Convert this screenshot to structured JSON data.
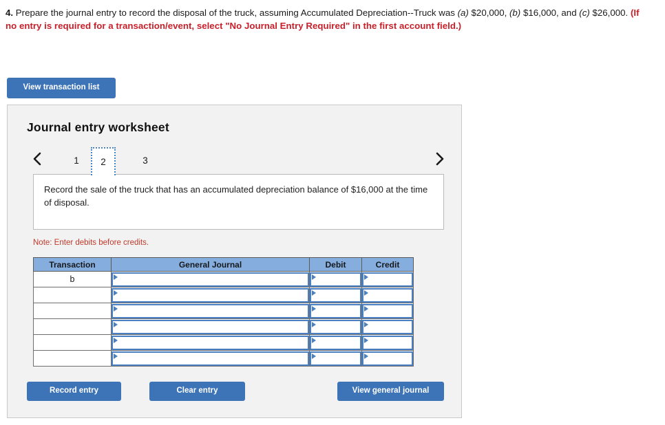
{
  "question": {
    "number": "4.",
    "part1": "Prepare the journal entry to record the disposal of the truck, assuming Accumulated Depreciation--Truck was ",
    "a_label": "(a)",
    "a_value": " $20,000, ",
    "b_label": "(b)",
    "b_value": " $16,000, and ",
    "c_label": "(c)",
    "c_value": " $26,000. ",
    "red_note": "(If no entry is required for a transaction/event, select \"No Journal Entry Required\" in the first account field.)"
  },
  "toolbar": {
    "view_transaction_list": "View transaction list"
  },
  "panel": {
    "title": "Journal entry worksheet",
    "nav": {
      "prev_icon": "chevron-left-icon",
      "next_icon": "chevron-right-icon",
      "tabs": [
        {
          "label": "1",
          "active": false
        },
        {
          "label": "2",
          "active": true
        },
        {
          "label": "3",
          "active": false
        }
      ]
    },
    "description": "Record the sale of the truck that has an accumulated depreciation balance of $16,000 at the time of disposal.",
    "note": "Note: Enter debits before credits."
  },
  "table": {
    "headers": [
      "Transaction",
      "General Journal",
      "Debit",
      "Credit"
    ],
    "rows": [
      {
        "transaction": "b",
        "general_journal": "",
        "debit": "",
        "credit": ""
      },
      {
        "transaction": "",
        "general_journal": "",
        "debit": "",
        "credit": ""
      },
      {
        "transaction": "",
        "general_journal": "",
        "debit": "",
        "credit": ""
      },
      {
        "transaction": "",
        "general_journal": "",
        "debit": "",
        "credit": ""
      },
      {
        "transaction": "",
        "general_journal": "",
        "debit": "",
        "credit": ""
      },
      {
        "transaction": "",
        "general_journal": "",
        "debit": "",
        "credit": ""
      }
    ]
  },
  "actions": {
    "record_entry": "Record entry",
    "clear_entry": "Clear entry",
    "view_general_journal": "View general journal"
  },
  "colors": {
    "button_blue": "#3d74b8",
    "header_blue": "#85aede",
    "input_border_blue": "#4a7fc1",
    "red_text": "#c8202a",
    "note_red": "#c0392b",
    "panel_bg": "#f2f2f2"
  }
}
